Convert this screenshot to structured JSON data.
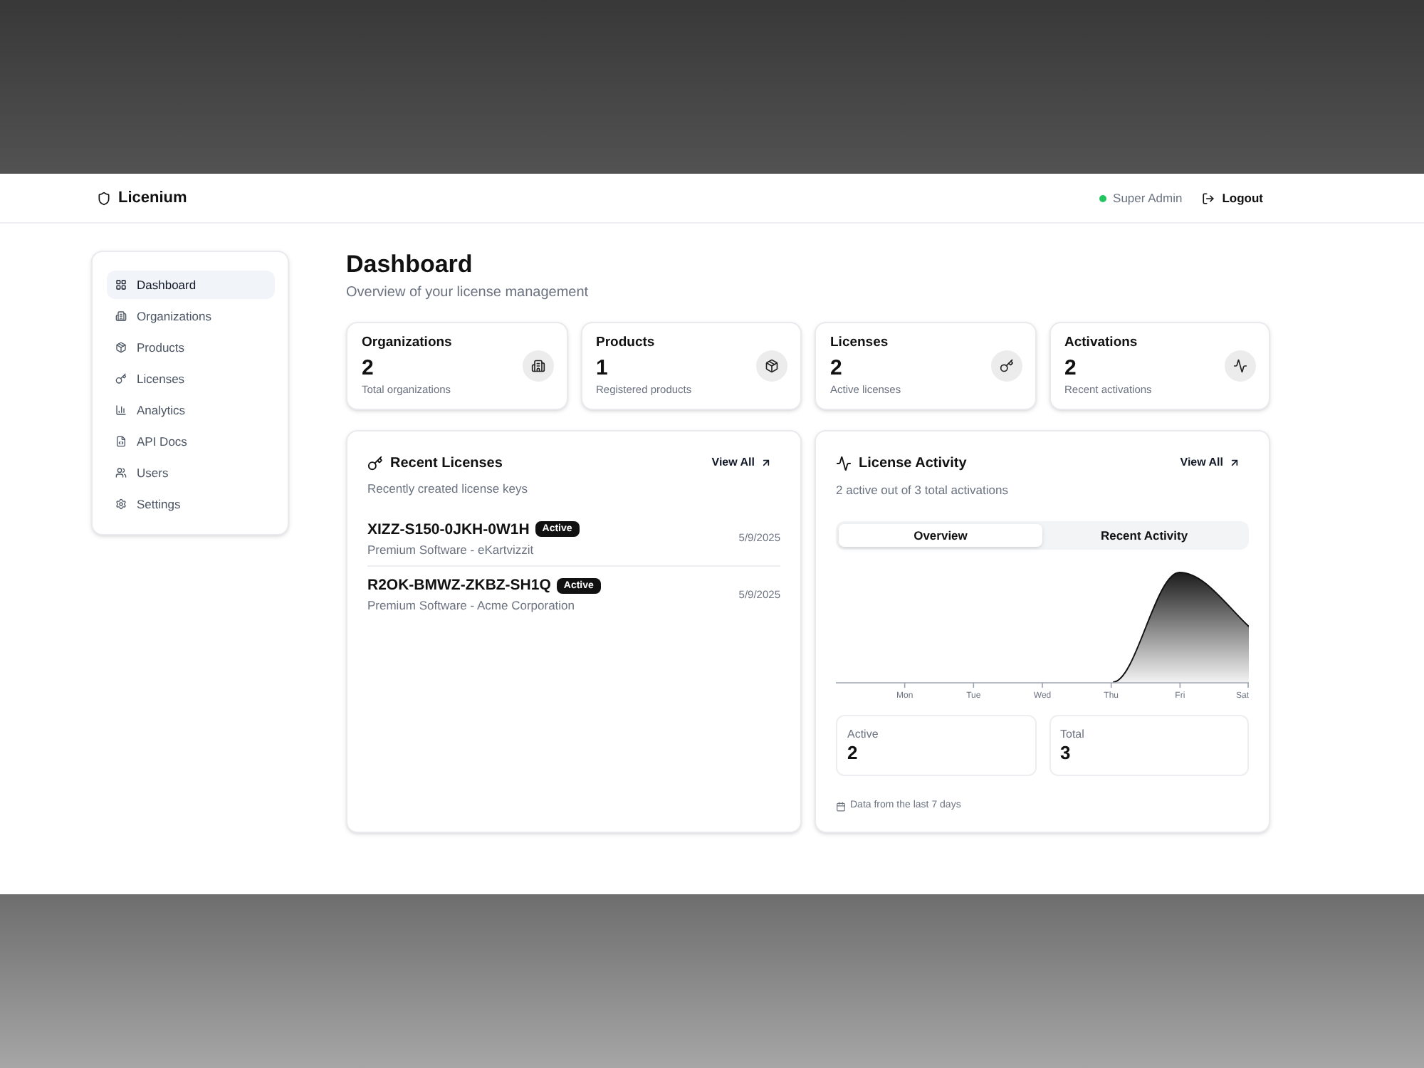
{
  "app": {
    "name": "Licenium"
  },
  "header": {
    "user": "Super Admin",
    "logout": "Logout"
  },
  "sidebar": {
    "items": [
      {
        "label": "Dashboard",
        "selected": true
      },
      {
        "label": "Organizations",
        "selected": false
      },
      {
        "label": "Products",
        "selected": false
      },
      {
        "label": "Licenses",
        "selected": false
      },
      {
        "label": "Analytics",
        "selected": false
      },
      {
        "label": "API Docs",
        "selected": false
      },
      {
        "label": "Users",
        "selected": false
      },
      {
        "label": "Settings",
        "selected": false
      }
    ]
  },
  "page": {
    "title": "Dashboard",
    "subtitle": "Overview of your license management"
  },
  "stats": [
    {
      "title": "Organizations",
      "value": "2",
      "caption": "Total organizations"
    },
    {
      "title": "Products",
      "value": "1",
      "caption": "Registered products"
    },
    {
      "title": "Licenses",
      "value": "2",
      "caption": "Active licenses"
    },
    {
      "title": "Activations",
      "value": "2",
      "caption": "Recent activations"
    }
  ],
  "recent_licenses": {
    "title": "Recent Licenses",
    "subtitle": "Recently created license keys",
    "view_all": "View All",
    "items": [
      {
        "key": "XIZZ-S150-0JKH-0W1H",
        "status": "Active",
        "product": "Premium Software - eKartvizzit",
        "date": "5/9/2025"
      },
      {
        "key": "R2OK-BMWZ-ZKBZ-SH1Q",
        "status": "Active",
        "product": "Premium Software - Acme Corporation",
        "date": "5/9/2025"
      }
    ]
  },
  "license_activity": {
    "title": "License Activity",
    "subtitle": "2 active out of 3 total activations",
    "view_all": "View All",
    "tabs": [
      {
        "label": "Overview",
        "selected": true
      },
      {
        "label": "Recent Activity",
        "selected": false
      }
    ],
    "chart": {
      "x_labels": [
        "Mon",
        "Tue",
        "Wed",
        "Thu",
        "Fri",
        "Sat"
      ]
    },
    "summary": [
      {
        "label": "Active",
        "value": "2"
      },
      {
        "label": "Total",
        "value": "3"
      }
    ],
    "footnote": "Data from the last 7 days"
  }
}
